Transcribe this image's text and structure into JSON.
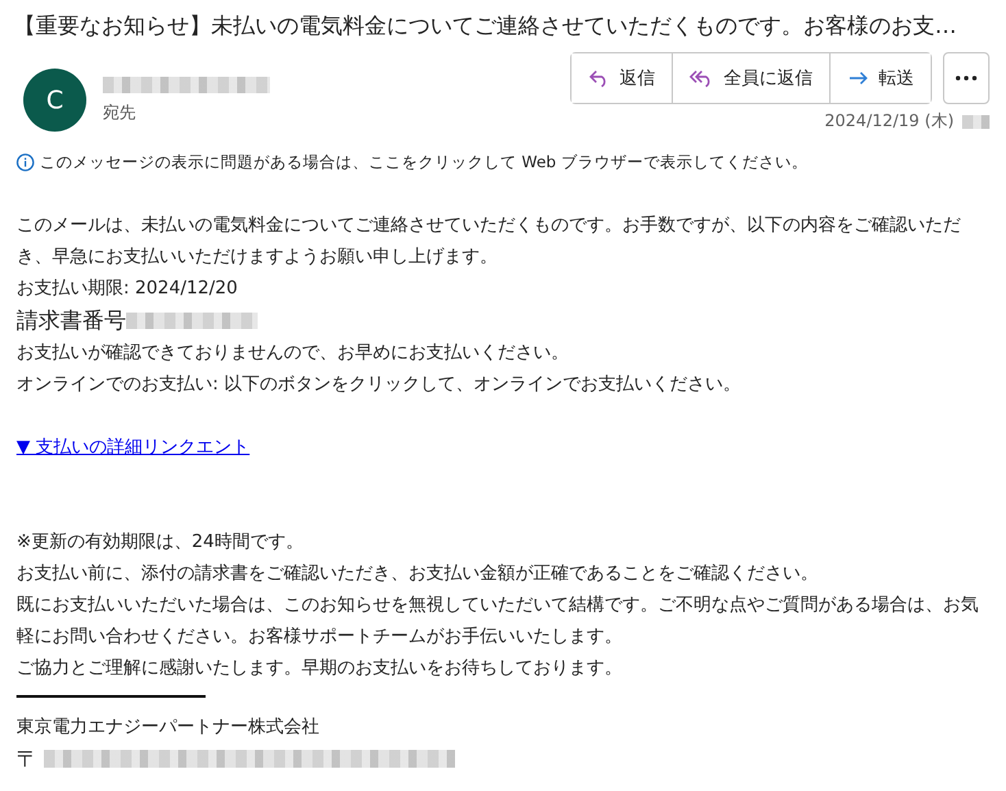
{
  "subject": "【重要なお知らせ】未払いの電気料金についてご連絡させていただくものです。お客様のお支…",
  "sender": {
    "avatar_letter": "C",
    "recipient_label": "宛先"
  },
  "actions": [
    {
      "kind": "reply",
      "label": "返信"
    },
    {
      "kind": "reply_all",
      "label": "全員に返信"
    },
    {
      "kind": "forward",
      "label": "転送"
    },
    {
      "kind": "more"
    }
  ],
  "date": "2024/12/19 (木)",
  "info_bar": "このメッセージの表示に問題がある場合は、ここをクリックして Web ブラウザーで表示してください。",
  "body": [
    {
      "kind": "paragraph",
      "text": "このメールは、未払いの電気料金についてご連絡させていただくものです。お手数ですが、以下の内容をご確認いただき、早急にお支払いいただけますようお願い申し上げます。"
    },
    {
      "kind": "paragraph",
      "text": "お支払い期限: 2024/12/20"
    },
    {
      "kind": "invoice",
      "text": "請求書番号"
    },
    {
      "kind": "paragraph",
      "text": "お支払いが確認できておりませんので、お早めにお支払いください。"
    },
    {
      "kind": "paragraph",
      "text": "オンラインでのお支払い: 以下のボタンをクリックして、オンラインでお支払いください。"
    },
    {
      "kind": "spacer"
    },
    {
      "kind": "link",
      "text": "▼ 支払いの詳細リンクエント"
    },
    {
      "kind": "spacer"
    },
    {
      "kind": "spacer"
    },
    {
      "kind": "paragraph",
      "text": "※更新の有効期限は、24時間です。"
    },
    {
      "kind": "paragraph",
      "text": "お支払い前に、添付の請求書をご確認いただき、お支払い金額が正確であることをご確認ください。"
    },
    {
      "kind": "paragraph",
      "text": "既にお支払いいただいた場合は、このお知らせを無視していただいて結構です。ご不明な点やご質問がある場合は、お気軽にお問い合わせください。お客様サポートチームがお手伝いいたします。"
    },
    {
      "kind": "paragraph",
      "text": "ご協力とご理解に感謝いたします。早期のお支払いをお待ちしております。"
    },
    {
      "kind": "rule"
    },
    {
      "kind": "paragraph",
      "text": "東京電力エナジーパートナー株式会社"
    },
    {
      "kind": "postal",
      "text": "〒"
    }
  ]
}
